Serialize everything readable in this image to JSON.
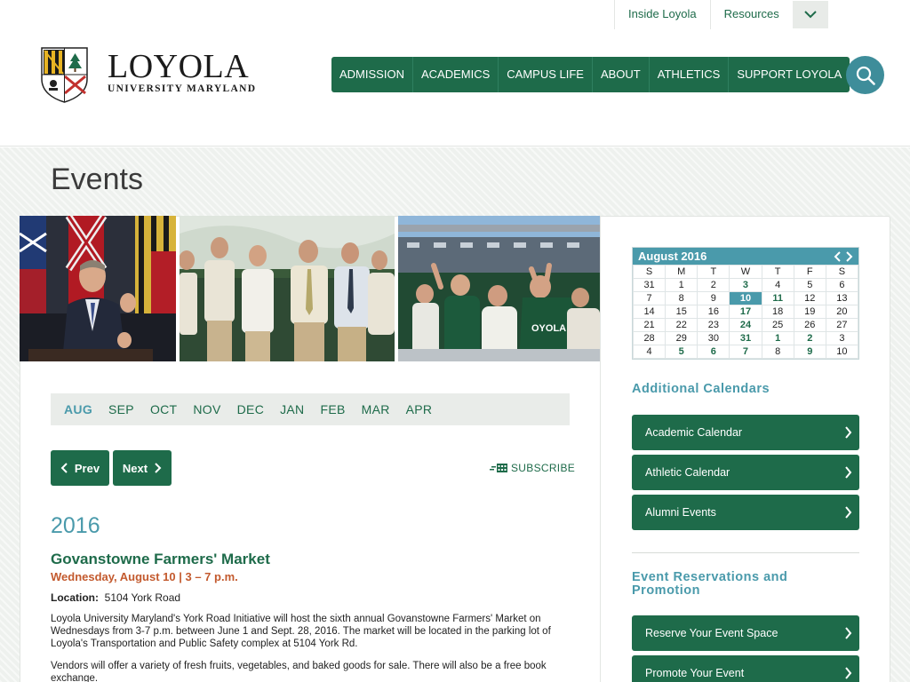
{
  "utility_nav": {
    "inside_loyola": "Inside Loyola",
    "resources": "Resources"
  },
  "logo": {
    "name": "LOYOLA",
    "subtitle": "UNIVERSITY MARYLAND"
  },
  "main_nav": [
    "ADMISSION",
    "ACADEMICS",
    "CAMPUS LIFE",
    "ABOUT",
    "ATHLETICS",
    "SUPPORT LOYOLA"
  ],
  "page_title": "Events",
  "months": [
    "AUG",
    "SEP",
    "OCT",
    "NOV",
    "DEC",
    "JAN",
    "FEB",
    "MAR",
    "APR"
  ],
  "active_month": "AUG",
  "pager": {
    "prev": "Prev",
    "next": "Next",
    "subscribe": "SUBSCRIBE"
  },
  "event_list": {
    "year": "2016",
    "title": "Govanstowne Farmers' Market",
    "date": "Wednesday, August 10 | 3 – 7 p.m.",
    "location_label": "Location:",
    "location": "5104 York Road",
    "description_1": "Loyola University Maryland's York Road Initiative will host the sixth annual Govanstowne Farmers' Market on Wednesdays from 3-7 p.m. between June 1 and Sept. 28, 2016. The market will be located in the parking lot of Loyola's Transportation and Public Safety complex at 5104 York Rd.",
    "description_2": "Vendors will offer a variety of fresh fruits, vegetables, and baked goods for sale. There will also be a free book exchange."
  },
  "calendar": {
    "month_label": "August 2016",
    "weekdays": [
      "S",
      "M",
      "T",
      "W",
      "T",
      "F",
      "S"
    ],
    "weeks": [
      [
        {
          "d": "31"
        },
        {
          "d": "1"
        },
        {
          "d": "2"
        },
        {
          "d": "3",
          "ev": true
        },
        {
          "d": "4"
        },
        {
          "d": "5"
        },
        {
          "d": "6"
        }
      ],
      [
        {
          "d": "7"
        },
        {
          "d": "8"
        },
        {
          "d": "9"
        },
        {
          "d": "10",
          "today": true
        },
        {
          "d": "11",
          "ev": true
        },
        {
          "d": "12"
        },
        {
          "d": "13"
        }
      ],
      [
        {
          "d": "14"
        },
        {
          "d": "15"
        },
        {
          "d": "16"
        },
        {
          "d": "17",
          "ev": true
        },
        {
          "d": "18"
        },
        {
          "d": "19"
        },
        {
          "d": "20"
        }
      ],
      [
        {
          "d": "21"
        },
        {
          "d": "22"
        },
        {
          "d": "23"
        },
        {
          "d": "24",
          "ev": true
        },
        {
          "d": "25"
        },
        {
          "d": "26"
        },
        {
          "d": "27"
        }
      ],
      [
        {
          "d": "28"
        },
        {
          "d": "29"
        },
        {
          "d": "30"
        },
        {
          "d": "31",
          "ev": true
        },
        {
          "d": "1",
          "ev": true
        },
        {
          "d": "2",
          "ev": true
        },
        {
          "d": "3"
        }
      ],
      [
        {
          "d": "4"
        },
        {
          "d": "5",
          "ev": true
        },
        {
          "d": "6",
          "ev": true
        },
        {
          "d": "7",
          "ev": true
        },
        {
          "d": "8"
        },
        {
          "d": "9",
          "ev": true
        },
        {
          "d": "10"
        }
      ]
    ]
  },
  "additional_calendars": {
    "heading": "Additional Calendars",
    "links": [
      "Academic Calendar",
      "Athletic Calendar",
      "Alumni Events"
    ]
  },
  "reservations": {
    "heading": "Event Reservations and Promotion",
    "links": [
      "Reserve Your Event Space",
      "Promote Your Event"
    ]
  },
  "colors": {
    "green": "#1e6b4a",
    "teal": "#4a9aab",
    "orange": "#c35a2e"
  }
}
